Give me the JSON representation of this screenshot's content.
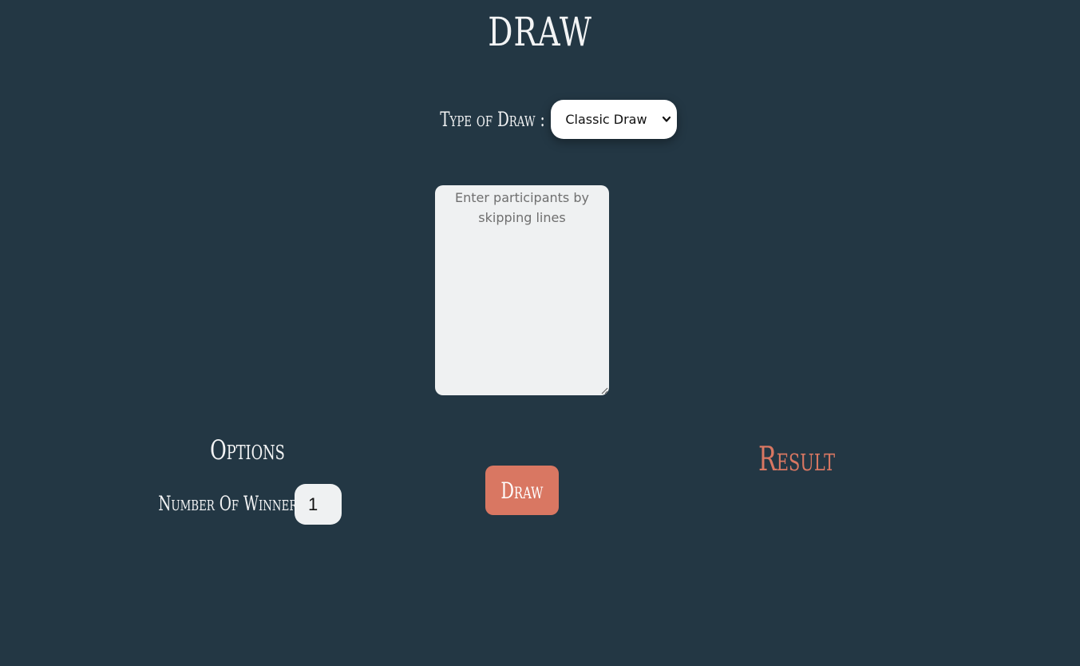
{
  "page": {
    "title": "DRAW"
  },
  "draw_type": {
    "label": "Type of Draw :",
    "selected": "Classic Draw"
  },
  "participants": {
    "placeholder": "Enter participants by skipping lines",
    "value": ""
  },
  "options": {
    "title": "Options",
    "winner_label": "Number Of Winner :",
    "winner_count": "1"
  },
  "actions": {
    "draw_label": "Draw"
  },
  "result": {
    "title": "Result"
  },
  "colors": {
    "background": "#233744",
    "accent": "#d97762",
    "text": "#f3f4f5",
    "field": "#eff1f2"
  },
  "icons": {
    "select": "chevron-down-icon",
    "textarea": "resize-handle-icon"
  }
}
